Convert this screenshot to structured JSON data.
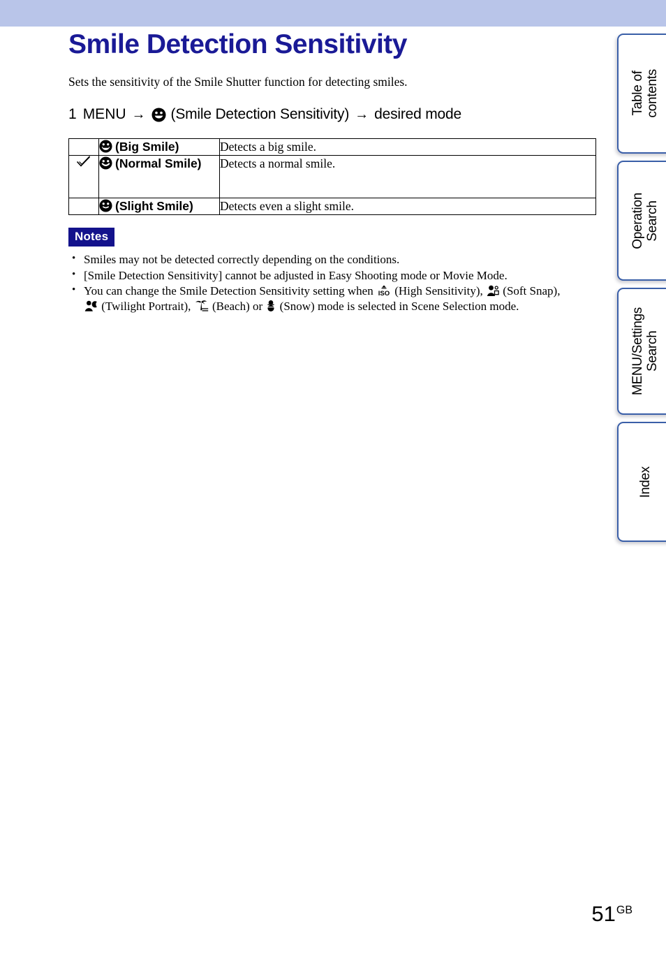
{
  "header": {
    "band_color": "#b9c5e9"
  },
  "page_title": "Smile Detection Sensitivity",
  "intro": "Sets the sensitivity of the Smile Shutter function for detecting smiles.",
  "step": {
    "number": "1",
    "menu_label": "MENU",
    "arrow1": "→",
    "icon": "smiley-face-icon",
    "setting_name": "(Smile Detection Sensitivity)",
    "arrow2": "→",
    "target": "desired mode"
  },
  "table": {
    "rows": [
      {
        "selected": false,
        "check": "",
        "icon": "smiley-big-smile-icon",
        "label": "(Big Smile)",
        "description": "Detects a big smile."
      },
      {
        "selected": true,
        "check": "✓",
        "icon": "smiley-normal-smile-icon",
        "label": "(Normal Smile)",
        "description": "Detects a normal smile."
      },
      {
        "selected": false,
        "check": "",
        "icon": "smiley-slight-smile-icon",
        "label": "(Slight Smile)",
        "description": "Detects even a slight smile."
      }
    ]
  },
  "notes": {
    "badge": "Notes",
    "items": [
      "Smiles may not be detected correctly depending on the conditions.",
      "[Smile Detection Sensitivity] cannot be adjusted in Easy Shooting mode or Movie Mode."
    ],
    "scene_note": {
      "part1": "You can change the Smile Detection Sensitivity setting when",
      "icon1": "iso-high-sensitivity-icon",
      "label1": "(High Sensitivity),",
      "icon2": "soft-snap-icon",
      "label2": "(Soft Snap),",
      "icon3": "twilight-portrait-icon",
      "label3": "(Twilight Portrait),",
      "icon4": "beach-icon",
      "label4": "(Beach) or",
      "icon5": "snow-icon",
      "label5": "(Snow) mode is selected in Scene Selection mode."
    }
  },
  "tabs": [
    {
      "label": "Table of\ncontents",
      "name": "table-of-contents"
    },
    {
      "label": "Operation\nSearch",
      "name": "operation-search"
    },
    {
      "label": "MENU/Settings\nSearch",
      "name": "menu-settings-search"
    },
    {
      "label": "Index",
      "name": "index"
    }
  ],
  "footer": {
    "page_number": "51",
    "page_suffix": "GB"
  }
}
